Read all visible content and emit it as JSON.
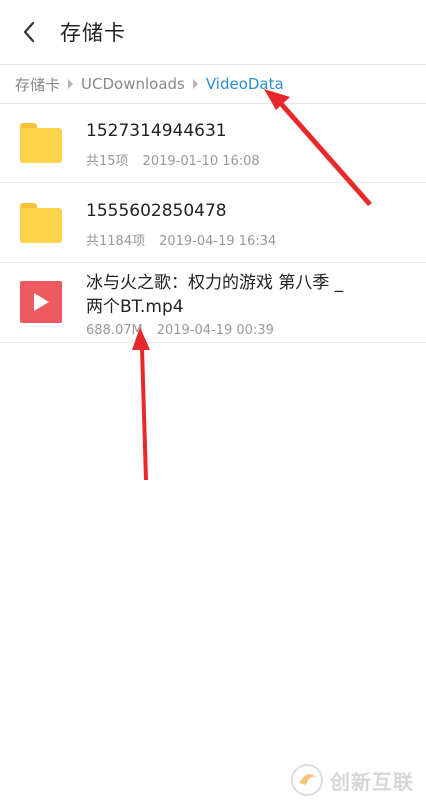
{
  "header": {
    "title": "存储卡"
  },
  "breadcrumb": [
    "存储卡",
    "UCDownloads",
    "VideoData"
  ],
  "files": [
    {
      "type": "folder",
      "name": "1527314944631",
      "count": "共15项",
      "date": "2019-01-10 16:08",
      "icon": "folder-icon"
    },
    {
      "type": "folder",
      "name": "1555602850478",
      "count": "共1184项",
      "date": "2019-04-19 16:34",
      "icon": "folder-icon"
    },
    {
      "type": "video",
      "name_line1": "冰与火之歌：权力的游戏 第八季 _",
      "name_line2": "两个BT.mp4",
      "size": "688.07M",
      "date": "2019-04-19 00:39",
      "icon": "play-icon"
    }
  ],
  "colors": {
    "accent": "#2a8fd6",
    "folder": "#fcd34a",
    "video": "#ee5a5f",
    "arrow": "#e8292c"
  },
  "watermark": {
    "text": "创新互联"
  }
}
